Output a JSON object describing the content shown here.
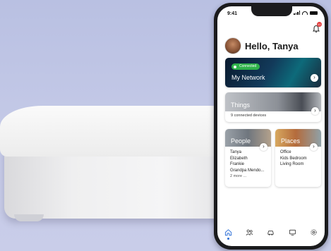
{
  "status": {
    "time": "9:41"
  },
  "notifications": {
    "count": "10"
  },
  "greeting": "Hello, Tanya",
  "network": {
    "badge": "Connected",
    "title": "My Network"
  },
  "things": {
    "title": "Things",
    "subtitle": "9 connected devices"
  },
  "people": {
    "title": "People",
    "items": [
      "Tanya",
      "Elizabeth",
      "Frankie",
      "Grandpa Mendo..."
    ],
    "more": "2 more ..."
  },
  "places": {
    "title": "Places",
    "items": [
      "Office",
      "Kids Bedroom",
      "Living Room"
    ]
  },
  "nav": {
    "icons": [
      "home-icon",
      "people-icon",
      "car-icon",
      "tv-icon",
      "gear-icon"
    ],
    "active": "home-icon"
  },
  "colors": {
    "connected": "#2fb24a",
    "badge": "#e23a3a",
    "active_nav": "#2d6fd6"
  }
}
